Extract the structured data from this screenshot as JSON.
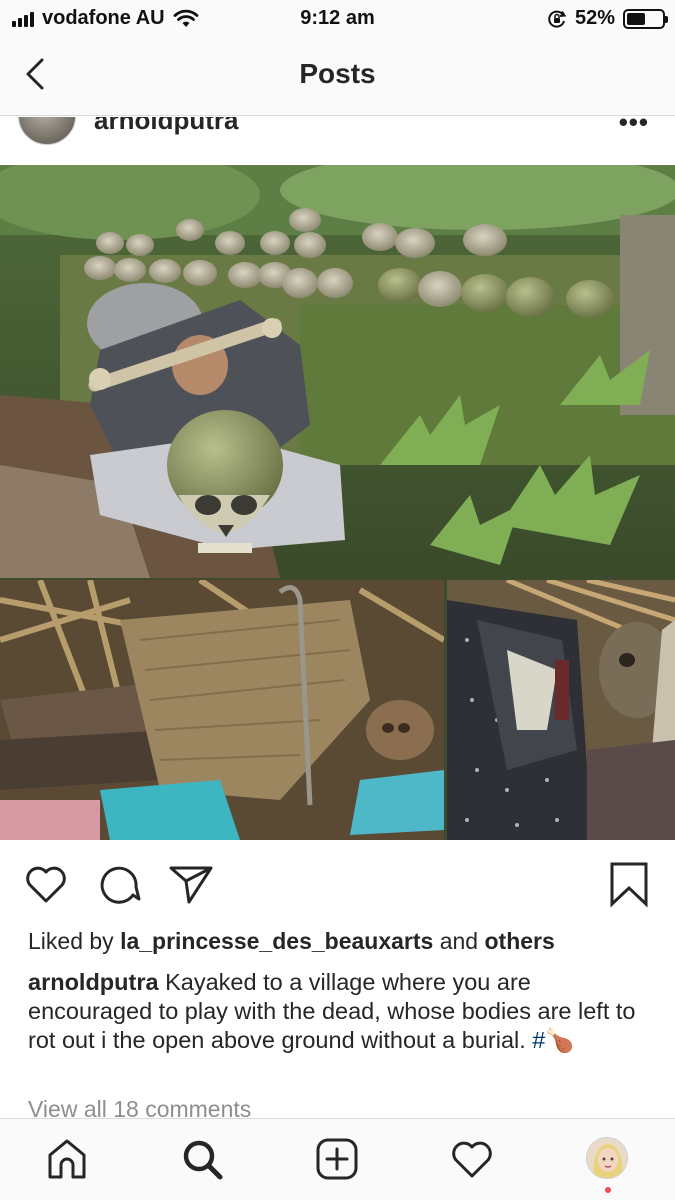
{
  "status_bar": {
    "carrier": "vodafone AU",
    "time": "9:12 am",
    "battery_percent": "52%",
    "battery_level": 0.52,
    "icons": [
      "signal-bars-icon",
      "wifi-icon",
      "orientation-lock-icon",
      "battery-icon"
    ]
  },
  "nav": {
    "title": "Posts",
    "back_icon": "chevron-left-icon"
  },
  "post": {
    "username": "arnoldputra",
    "more_icon": "more-dots-icon",
    "more_label": "•••",
    "images": [
      "photo-skulls-forest",
      "photo-remains-mat",
      "photo-remains-jacket"
    ],
    "actions": {
      "like_icon": "heart-outline-icon",
      "comment_icon": "comment-bubble-icon",
      "share_icon": "paper-plane-icon",
      "save_icon": "bookmark-icon"
    },
    "likes": {
      "prefix": "Liked by ",
      "liker": "la_princesse_des_beauxarts",
      "middle": " and ",
      "others": "others"
    },
    "caption": {
      "username": "arnoldputra",
      "text": " Kayaked to a village where you are encouraged to play with the dead, whose bodies are left to rot out i the open above ground without a burial. ",
      "hashtag": "#",
      "emoji": "🍗"
    },
    "view_comments": "View all 18 comments"
  },
  "tab_bar": {
    "items": [
      "home-icon",
      "search-icon",
      "new-post-icon",
      "activity-heart-icon",
      "profile-avatar"
    ]
  },
  "colors": {
    "text": "#262626",
    "muted": "#8e8e8e",
    "hashtag": "#00376b",
    "divider": "#dbdbdb",
    "notification_dot": "#ed4956"
  }
}
